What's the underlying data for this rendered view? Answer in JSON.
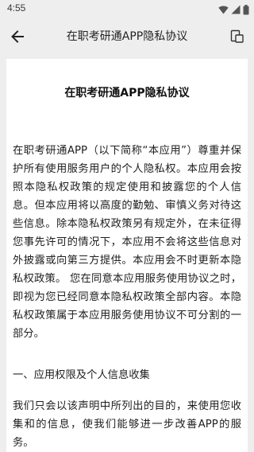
{
  "status_bar": {
    "time": "4:55"
  },
  "app_bar": {
    "title": "在职考研通APP隐私协议"
  },
  "document": {
    "title": "在职考研通APP隐私协议",
    "intro": "在职考研通APP（以下简称“本应用”）尊重并保护所有使用服务用户的个人隐私权。本应用会按照本隐私权政策的规定使用和披露您的个人信息。但本应用将以高度的勤勉、审慎义务对待这些信息。除本隐私权政策另有规定外，在未征得您事先许可的情况下，本应用不会将这些信息对外披露或向第三方提供。本应用会不时更新本隐私权政策。 您在同意本应用服务使用协议之时，即视为您已经同意本隐私权政策全部内容。本隐私权政策属于本应用服务使用协议不可分割的一部分。",
    "section_1": {
      "heading": "一、应用权限及个人信息收集",
      "paragraph": "我们只会以该声明中所列出的目的，来使用您收集和的信息，使我们能够进一步改善APP的服务。"
    }
  },
  "colors": {
    "bar_background": "#eeeeee",
    "card_background": "#ffffff",
    "text": "#1f1f1f"
  },
  "icons": {
    "status": [
      "wifi-icon",
      "signal-icon",
      "battery-icon"
    ],
    "back": "arrow-left-icon",
    "action": "document-icon"
  }
}
